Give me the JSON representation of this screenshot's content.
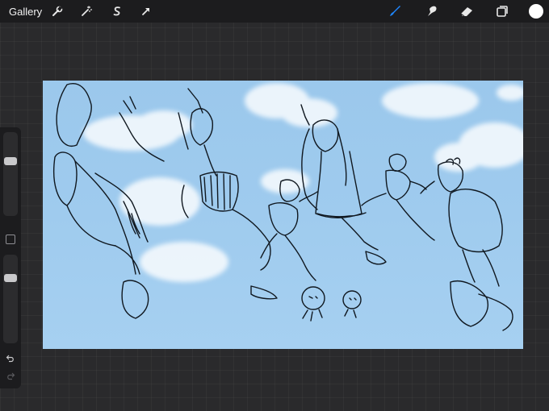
{
  "topbar": {
    "gallery_label": "Gallery",
    "left_tools": [
      "wrench-icon",
      "magic-wand-icon",
      "selection-s-icon",
      "transform-arrow-icon"
    ],
    "right_tools": [
      "brush-icon",
      "smudge-icon",
      "eraser-icon",
      "layers-icon"
    ],
    "active_tool": "brush",
    "current_color": "#ffffff",
    "accent": "#1e86ff"
  },
  "sidebar": {
    "brush_size_level": 0.33,
    "opacity_level": 0.24,
    "buttons": [
      "modify-square-icon",
      "undo-icon",
      "redo-icon"
    ]
  },
  "canvas": {
    "background": "#9fcbee",
    "content": "sketch-artwork"
  }
}
